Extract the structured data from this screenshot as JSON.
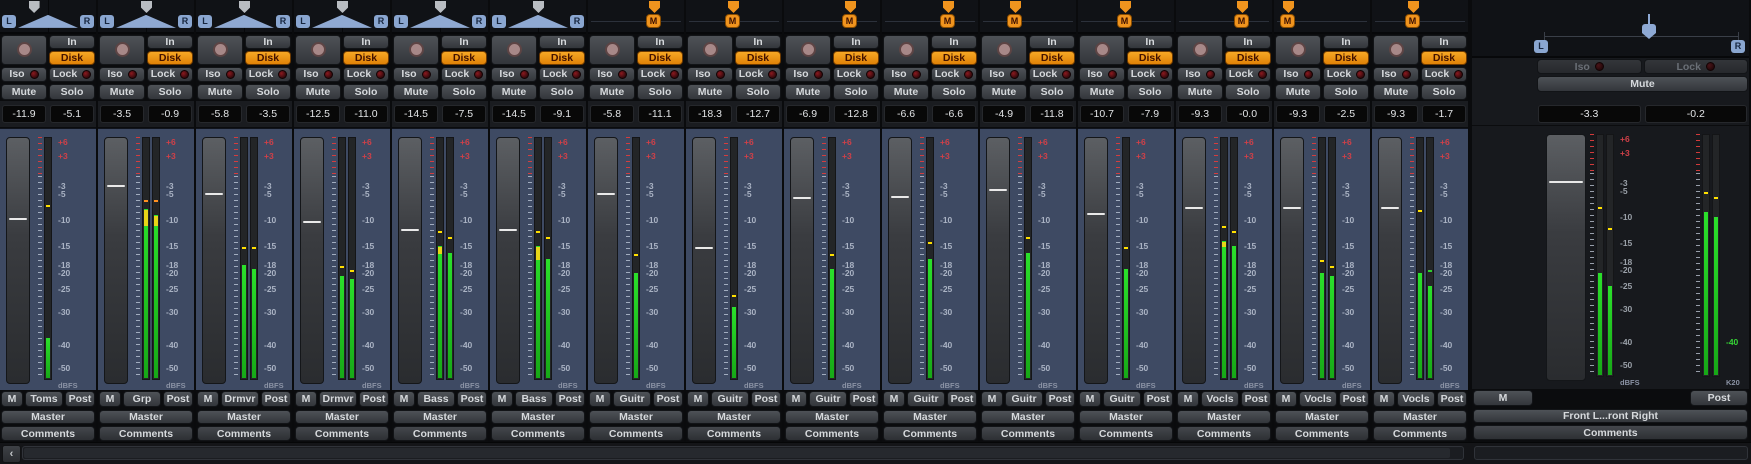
{
  "labels": {
    "in": "In",
    "disk": "Disk",
    "iso": "Iso",
    "lock": "Lock",
    "mute": "Mute",
    "solo": "Solo",
    "m": "M",
    "post": "Post",
    "master": "Master",
    "comments": "Comments",
    "l": "L",
    "r": "R",
    "scroll_left": "‹"
  },
  "colors": {
    "meter_green": "#1ecc1e",
    "meter_yellow": "#e8d518",
    "hold_orange": "#ff9020",
    "disk_orange": "#f09416",
    "navy_panel": "#3e4a63",
    "mono_marker": "#f0941e",
    "stereo_chip_blue": "#8aa6d0"
  },
  "meter_scale": {
    "over": [
      {
        "text": "+6",
        "db": 6
      },
      {
        "text": "+3",
        "db": 3
      }
    ],
    "labels": [
      {
        "text": "-3",
        "db": -3
      },
      {
        "text": "-5",
        "db": -5
      },
      {
        "text": "-10",
        "db": -10
      },
      {
        "text": "-15",
        "db": -15
      },
      {
        "text": "-18",
        "db": -18
      },
      {
        "text": "-20",
        "db": -20
      },
      {
        "text": "-25",
        "db": -25
      },
      {
        "text": "-30",
        "db": -30
      },
      {
        "text": "-40",
        "db": -40
      },
      {
        "text": "-50",
        "db": -50
      }
    ],
    "unit": "dBFS"
  },
  "master_output_scale": {
    "over": [],
    "labels": [
      {
        "text": "-40",
        "db": -40,
        "color": "#35d435"
      }
    ],
    "unit": "K20"
  },
  "strips": [
    {
      "name": "Toms",
      "fader": "-11.9",
      "peak": "-5.1",
      "fader_db": -11.9,
      "pan": {
        "mode": "stereo",
        "pos": 0.35
      },
      "bars": [
        {
          "level": -38,
          "hold": -7
        }
      ]
    },
    {
      "name": "Grp",
      "fader": "-3.5",
      "peak": "-0.9",
      "fader_db": -3.5,
      "pan": {
        "mode": "stereo",
        "pos": 0.5
      },
      "bars": [
        {
          "level": -8,
          "yellow_from": -11,
          "hold": -6,
          "hold_color": "#ff9020"
        },
        {
          "level": -9,
          "yellow_from": -11,
          "hold": -6,
          "hold_color": "#ff9020"
        }
      ]
    },
    {
      "name": "Drmvr",
      "fader": "-5.8",
      "peak": "-3.5",
      "fader_db": -5.8,
      "pan": {
        "mode": "stereo",
        "pos": 0.5
      },
      "bars": [
        {
          "level": -18,
          "hold": -15
        },
        {
          "level": -19,
          "hold": -15
        }
      ]
    },
    {
      "name": "Drmvr",
      "fader": "-12.5",
      "peak": "-11.0",
      "fader_db": -12.5,
      "pan": {
        "mode": "stereo",
        "pos": 0.5
      },
      "bars": [
        {
          "level": -21,
          "hold": -18
        },
        {
          "level": -22,
          "hold": -19
        }
      ]
    },
    {
      "name": "Bass",
      "fader": "-14.5",
      "peak": "-7.5",
      "fader_db": -14.5,
      "pan": {
        "mode": "stereo",
        "pos": 0.5
      },
      "bars": [
        {
          "level": -15,
          "yellow_from": -16,
          "hold": -12
        },
        {
          "level": -16,
          "hold": -13
        }
      ]
    },
    {
      "name": "Bass",
      "fader": "-14.5",
      "peak": "-9.1",
      "fader_db": -14.5,
      "pan": {
        "mode": "stereo",
        "pos": 0.5
      },
      "bars": [
        {
          "level": -15,
          "yellow_from": -17,
          "hold": -12
        },
        {
          "level": -17,
          "hold": -13
        }
      ]
    },
    {
      "name": "Guitr",
      "fader": "-5.8",
      "peak": "-11.1",
      "fader_db": -5.8,
      "pan": {
        "mode": "mono",
        "pos": 0.74
      },
      "bars": [
        {
          "level": -20,
          "hold": -16
        }
      ]
    },
    {
      "name": "Guitr",
      "fader": "-18.3",
      "peak": "-12.7",
      "fader_db": -18.3,
      "pan": {
        "mode": "mono",
        "pos": 0.5
      },
      "bars": [
        {
          "level": -29,
          "hold": -26
        }
      ]
    },
    {
      "name": "Guitr",
      "fader": "-6.9",
      "peak": "-12.8",
      "fader_db": -6.9,
      "pan": {
        "mode": "mono",
        "pos": 0.74
      },
      "bars": [
        {
          "level": -19,
          "hold": -16
        }
      ]
    },
    {
      "name": "Guitr",
      "fader": "-6.6",
      "peak": "-6.6",
      "fader_db": -6.6,
      "pan": {
        "mode": "mono",
        "pos": 0.74
      },
      "bars": [
        {
          "level": -17,
          "hold": -14
        }
      ]
    },
    {
      "name": "Guitr",
      "fader": "-4.9",
      "peak": "-11.8",
      "fader_db": -4.9,
      "pan": {
        "mode": "mono",
        "pos": 0.35
      },
      "bars": [
        {
          "level": -16,
          "hold": -13
        }
      ]
    },
    {
      "name": "Guitr",
      "fader": "-10.7",
      "peak": "-7.9",
      "fader_db": -10.7,
      "pan": {
        "mode": "mono",
        "pos": 0.5
      },
      "bars": [
        {
          "level": -19,
          "hold": -15
        }
      ]
    },
    {
      "name": "Vocls",
      "fader": "-9.3",
      "peak": "-0.0",
      "fader_db": -9.3,
      "pan": {
        "mode": "mono",
        "pos": 0.74
      },
      "bars": [
        {
          "level": -14,
          "yellow_from": -15,
          "hold": -11
        },
        {
          "level": -15,
          "hold": -12
        }
      ]
    },
    {
      "name": "Vocls",
      "fader": "-9.3",
      "peak": "-2.5",
      "fader_db": -9.3,
      "pan": {
        "mode": "mono",
        "pos": 0.08
      },
      "bars": [
        {
          "level": -20,
          "hold": -17
        },
        {
          "level": -21,
          "hold": -18
        }
      ]
    },
    {
      "name": "Vocls",
      "fader": "-9.3",
      "peak": "-1.7",
      "fader_db": -9.3,
      "pan": {
        "mode": "mono",
        "pos": 0.42
      },
      "bars": [
        {
          "level": -20,
          "hold": -8
        },
        {
          "level": -24,
          "hold": -19,
          "hold_color": "#2ecc2e"
        }
      ]
    }
  ],
  "master": {
    "fader": "-3.3",
    "peak": "-0.2",
    "fader_db": -3.3,
    "output_name": "Front L...ront Right",
    "bars_a": [
      {
        "level": -21,
        "hold": -8
      },
      {
        "level": -25,
        "hold": -12
      }
    ],
    "bars_b": [
      {
        "level": -9,
        "hold": -5
      },
      {
        "level": -10,
        "hold": -6
      }
    ]
  }
}
